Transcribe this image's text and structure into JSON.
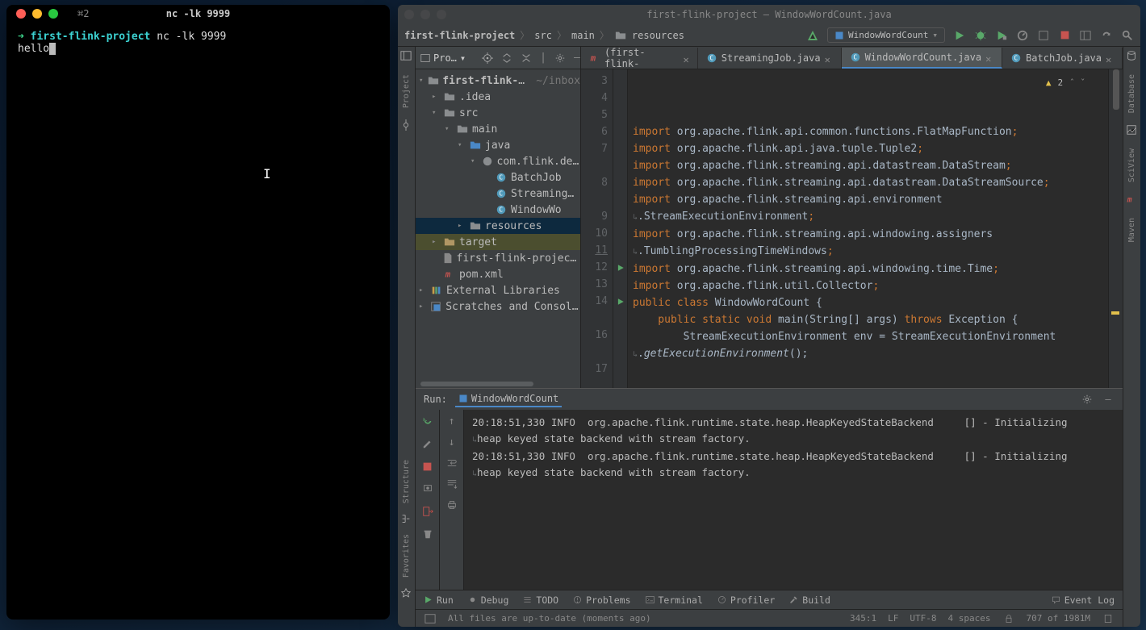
{
  "terminal": {
    "tab_prefix": "⌘2",
    "title": "nc -lk 9999",
    "prompt_dir": "first-flink-project",
    "command": "nc -lk 9999",
    "input": "hello"
  },
  "ide": {
    "title": "first-flink-project – WindowWordCount.java",
    "breadcrumbs": [
      "first-flink-project",
      "src",
      "main",
      "resources"
    ],
    "run_config": "WindowWordCount",
    "project_panel_title": "Pro…",
    "tree": {
      "root": "first-flink-project",
      "root_hint": "~/inbox",
      "idea": ".idea",
      "src": "src",
      "main": "main",
      "java": "java",
      "pkg": "com.flink.demo",
      "batch": "BatchJob",
      "streaming": "StreamingJo",
      "window": "WindowWo",
      "resources": "resources",
      "target": "target",
      "iml": "first-flink-project.iml",
      "pom": "pom.xml",
      "ext": "External Libraries",
      "scratch": "Scratches and Consoles"
    },
    "tabs": [
      {
        "label": "pom.xml (first-flink-project)",
        "icon": "maven",
        "active": false
      },
      {
        "label": "StreamingJob.java",
        "icon": "java",
        "active": false
      },
      {
        "label": "WindowWordCount.java",
        "icon": "java",
        "active": true
      },
      {
        "label": "BatchJob.java",
        "icon": "java",
        "active": false
      }
    ],
    "editor": {
      "warn_count": "2",
      "line_nums": [
        "3",
        "4",
        "5",
        "6",
        "7",
        "",
        "8",
        "",
        "9",
        "10",
        "11",
        "12",
        "13",
        "14",
        "",
        "16",
        "",
        "17",
        ""
      ],
      "underline": [
        11
      ],
      "run_marks": {
        "12": true,
        "14": true
      },
      "lines": [
        {
          "segments": [
            [
              "import ",
              "kw"
            ],
            [
              "org.apache.flink.api.common.functions.FlatMapFunction",
              "pkg"
            ],
            [
              ";",
              "pun"
            ]
          ]
        },
        {
          "segments": [
            [
              "import ",
              "kw"
            ],
            [
              "org.apache.flink.api.java.tuple.Tuple2",
              "pkg"
            ],
            [
              ";",
              "pun"
            ]
          ]
        },
        {
          "segments": [
            [
              "import ",
              "kw"
            ],
            [
              "org.apache.flink.streaming.api.datastream.DataStream",
              "pkg"
            ],
            [
              ";",
              "pun"
            ]
          ]
        },
        {
          "segments": [
            [
              "import ",
              "kw"
            ],
            [
              "org.apache.flink.streaming.api.datastream.DataStreamSource",
              "pkg"
            ],
            [
              ";",
              "pun"
            ]
          ]
        },
        {
          "segments": [
            [
              "import ",
              "kw"
            ],
            [
              "org.apache.flink.streaming.api.environment",
              "pkg"
            ]
          ]
        },
        {
          "wrap": true,
          "segments": [
            [
              ".StreamExecutionEnvironment",
              "pkg"
            ],
            [
              ";",
              "pun"
            ]
          ]
        },
        {
          "segments": [
            [
              "import ",
              "kw"
            ],
            [
              "org.apache.flink.streaming.api.windowing.assigners",
              "pkg"
            ]
          ]
        },
        {
          "wrap": true,
          "segments": [
            [
              ".TumblingProcessingTimeWindows",
              "pkg"
            ],
            [
              ";",
              "pun"
            ]
          ]
        },
        {
          "segments": [
            [
              "import ",
              "kw"
            ],
            [
              "org.apache.flink.streaming.api.windowing.time.Time",
              "pkg"
            ],
            [
              ";",
              "pun"
            ]
          ]
        },
        {
          "segments": [
            [
              "import ",
              "kw"
            ],
            [
              "org.apache.flink.util.Collector",
              "pkg"
            ],
            [
              ";",
              "pun"
            ]
          ]
        },
        {
          "segments": [
            [
              "",
              ""
            ]
          ]
        },
        {
          "segments": [
            [
              "public class ",
              "kw"
            ],
            [
              "WindowWordCount",
              "cls"
            ],
            [
              " {",
              "pkg"
            ]
          ]
        },
        {
          "segments": [
            [
              "",
              ""
            ]
          ]
        },
        {
          "segments": [
            [
              "    public static void ",
              "kw"
            ],
            [
              "main",
              "cls"
            ],
            [
              "(String[] args) ",
              "pkg"
            ],
            [
              "throws ",
              "kw"
            ],
            [
              "Exception {",
              "pkg"
            ]
          ]
        },
        {
          "segments": [
            [
              "",
              ""
            ]
          ]
        },
        {
          "segments": [
            [
              "        StreamExecutionEnvironment env = StreamExecutionEnvironment",
              "pkg"
            ]
          ]
        },
        {
          "wrap": true,
          "segments": [
            [
              ".",
              "pkg"
            ],
            [
              "getExecutionEnvironment",
              "it"
            ],
            [
              "();",
              "pkg"
            ]
          ]
        },
        {
          "segments": [
            [
              "",
              ""
            ]
          ]
        },
        {
          "segments": [
            [
              "",
              ""
            ]
          ]
        }
      ]
    },
    "run_panel": {
      "label": "Run:",
      "config": "WindowWordCount",
      "console_lines": [
        "20:18:51,330 INFO  org.apache.flink.runtime.state.heap.HeapKeyedStateBackend     [] - Initializing ",
        "heap keyed state backend with stream factory.",
        "20:18:51,330 INFO  org.apache.flink.runtime.state.heap.HeapKeyedStateBackend     [] - Initializing ",
        "heap keyed state backend with stream factory."
      ]
    },
    "bottom_tools": {
      "run": "Run",
      "debug": "Debug",
      "todo": "TODO",
      "problems": "Problems",
      "terminal": "Terminal",
      "profiler": "Profiler",
      "build": "Build",
      "eventlog": "Event Log"
    },
    "status": {
      "vcs": "All files are up-to-date (moments ago)",
      "pos": "345:1",
      "le": "LF",
      "enc": "UTF-8",
      "indent": "4 spaces",
      "mem": "707 of 1981M"
    },
    "left_tools": {
      "project": "Project",
      "structure": "Structure",
      "favorites": "Favorites"
    },
    "right_tools": {
      "database": "Database",
      "sciview": "SciView",
      "maven": "Maven"
    }
  },
  "colors": {
    "red": "#ff5f57",
    "yellow": "#febc2e",
    "green": "#28c840",
    "play": "#59a869",
    "stop": "#c75450",
    "folder": "#8a8d8f",
    "folder_sel": "#b09764",
    "maven": "#82aaff",
    "java": "#519aba"
  }
}
